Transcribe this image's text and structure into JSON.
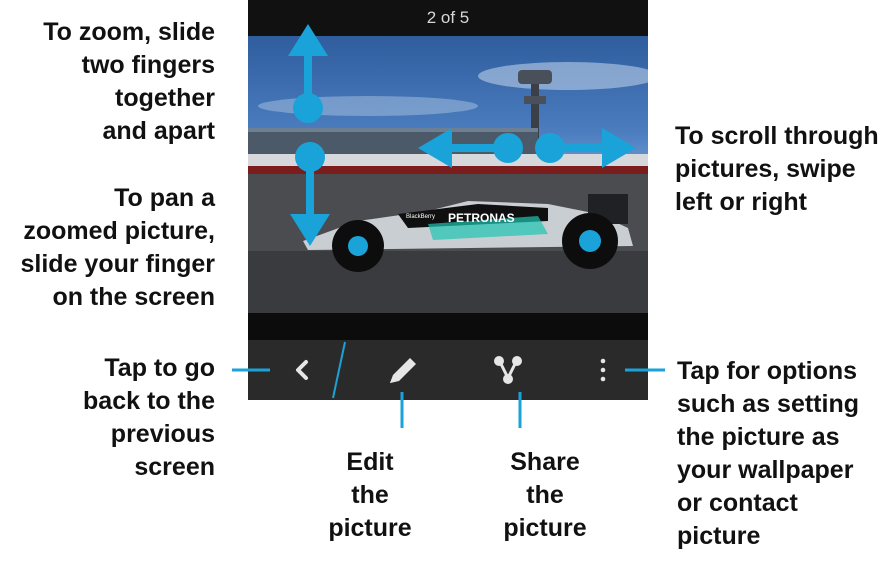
{
  "viewer": {
    "counter": "2 of 5"
  },
  "photo": {
    "sponsor_text": "PETRONAS",
    "sponsor_small": "BlackBerry"
  },
  "action_bar": {
    "back_icon": "chevron-left-icon",
    "edit_icon": "pencil-icon",
    "share_icon": "share-icon",
    "more_icon": "overflow-menu-icon"
  },
  "annotations": {
    "zoom": [
      "To zoom, slide",
      "two fingers",
      "together",
      "and apart"
    ],
    "pan": [
      "To pan a",
      "zoomed picture,",
      "slide your finger",
      "on the screen"
    ],
    "scroll": [
      "To scroll through",
      "pictures, swipe",
      "left or right"
    ],
    "back": [
      "Tap to go",
      "back to the",
      "previous",
      "screen"
    ],
    "edit": [
      "Edit",
      "the",
      "picture"
    ],
    "share": [
      "Share",
      "the",
      "picture"
    ],
    "options": [
      "Tap for options",
      "such as setting",
      "the picture as",
      "your wallpaper",
      "or contact",
      "picture"
    ]
  },
  "colors": {
    "accent": "#1aa3d9",
    "text": "#111111",
    "bar": "#2a2a2a"
  }
}
